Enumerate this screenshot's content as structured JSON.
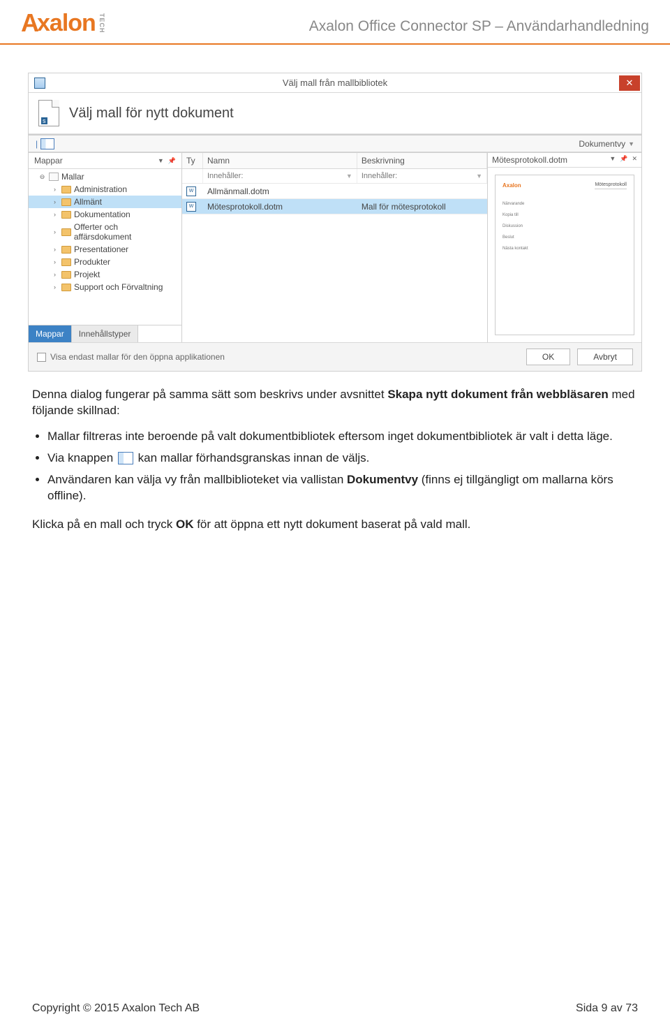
{
  "header": {
    "logo_text": "Axalon",
    "logo_tech": "TECH",
    "title": "Axalon Office Connector SP – Användarhandledning"
  },
  "dialog": {
    "title": "Välj mall från mallbibliotek",
    "heading": "Välj mall för nytt dokument",
    "view_dropdown": "Dokumentvy",
    "sidebar": {
      "title": "Mappar",
      "root": "Mallar",
      "items": [
        "Administration",
        "Allmänt",
        "Dokumentation",
        "Offerter och affärsdokument",
        "Presentationer",
        "Produkter",
        "Projekt",
        "Support och Förvaltning"
      ],
      "selected_index": 1,
      "tabs": {
        "mappar": "Mappar",
        "innehall": "Innehållstyper"
      }
    },
    "grid": {
      "col_ty": "Ty",
      "col_namn": "Namn",
      "col_besk": "Beskrivning",
      "filter_label": "Innehåller:",
      "rows": [
        {
          "namn": "Allmänmall.dotm",
          "besk": ""
        },
        {
          "namn": "Mötesprotokoll.dotm",
          "besk": "Mall för mötesprotokoll"
        }
      ],
      "selected_index": 1
    },
    "preview": {
      "title": "Mötesprotokoll.dotm",
      "pv_logo": "Axalon",
      "pv_doc_title": "Mötesprotokoll",
      "lines": [
        "Närvarande",
        "Kopia till",
        "Diskussion",
        "Beslut",
        "Nästa kontakt"
      ]
    },
    "footer": {
      "checkbox_label": "Visa endast mallar för den öppna applikationen",
      "ok": "OK",
      "cancel": "Avbryt"
    }
  },
  "body": {
    "intro_1": "Denna dialog fungerar på samma sätt som beskrivs under avsnittet ",
    "intro_bold": "Skapa nytt dokument från webbläsaren",
    "intro_2": " med följande skillnad:",
    "bullets": {
      "b1": "Mallar filtreras inte beroende på valt dokumentbibliotek eftersom inget dokumentbibliotek är valt i detta läge.",
      "b2_a": "Via knappen ",
      "b2_b": " kan mallar förhandsgranskas innan de väljs.",
      "b3_a": "Användaren kan välja vy från mallbiblioteket via vallistan ",
      "b3_bold": "Dokumentvy",
      "b3_b": " (finns ej tillgängligt om mallarna körs offline)."
    },
    "outro_a": "Klicka på en mall och tryck ",
    "outro_bold": "OK",
    "outro_b": " för att öppna ett nytt dokument baserat på vald mall."
  },
  "footer": {
    "copyright": "Copyright © 2015 Axalon Tech AB",
    "page": "Sida 9 av 73"
  }
}
